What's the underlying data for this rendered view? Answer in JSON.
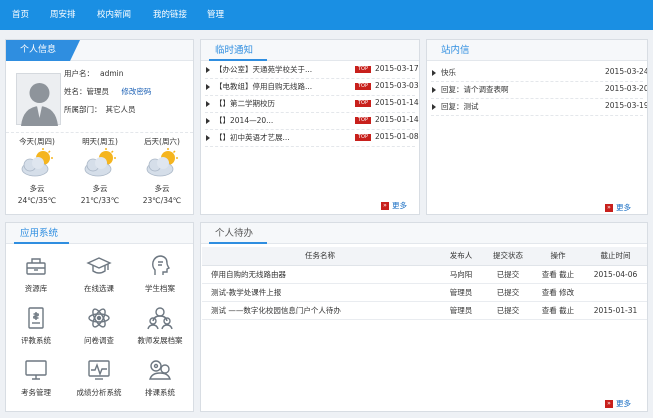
{
  "nav": [
    "首页",
    "周安排",
    "校内新闻",
    "我的链接",
    "管理"
  ],
  "personal": {
    "title": "个人信息",
    "username_label": "用户名：",
    "username": "admin",
    "name_label": "姓名：",
    "name": "管理员",
    "change_password": "修改密码",
    "dept_label": "所属部门：",
    "dept": "其它人员"
  },
  "weather": [
    {
      "day": "今天(周四)",
      "desc": "多云",
      "temp": "24℃/35℃",
      "icon": "partly-cloudy-icon"
    },
    {
      "day": "明天(周五)",
      "desc": "多云",
      "temp": "21℃/33℃",
      "icon": "partly-cloudy-icon"
    },
    {
      "day": "后天(周六)",
      "desc": "多云",
      "temp": "23℃/34℃",
      "icon": "partly-cloudy-icon"
    }
  ],
  "notices": {
    "title": "临时通知",
    "items": [
      {
        "title": "【办公室】天通苑学校关于...",
        "badge": "TOP",
        "date": "2015-03-17"
      },
      {
        "title": "【电教组】停用自购无线路...",
        "badge": "TOP",
        "date": "2015-03-03"
      },
      {
        "title": "【】第二学期校历",
        "badge": "TOP",
        "date": "2015-01-14"
      },
      {
        "title": "【】2014—20...",
        "badge": "TOP",
        "date": "2015-01-14"
      },
      {
        "title": "【】初中英语才艺展...",
        "badge": "TOP",
        "date": "2015-01-08"
      }
    ],
    "more": "更多"
  },
  "messages": {
    "title": "站内信",
    "items": [
      {
        "title": "快乐",
        "date": "2015-03-24"
      },
      {
        "title": "回复：请个调查表啊",
        "date": "2015-03-20"
      },
      {
        "title": "回复：测试",
        "date": "2015-03-19"
      }
    ],
    "more": "更多"
  },
  "apps": {
    "title": "应用系统",
    "items": [
      {
        "label": "资源库",
        "icon": "resource-icon"
      },
      {
        "label": "在线选课",
        "icon": "graduation-cap-icon"
      },
      {
        "label": "学生档案",
        "icon": "student-profile-icon"
      },
      {
        "label": "评教系统",
        "icon": "evaluation-icon"
      },
      {
        "label": "问卷调查",
        "icon": "survey-icon"
      },
      {
        "label": "教师发展档案",
        "icon": "teacher-group-icon"
      },
      {
        "label": "考务管理",
        "icon": "monitor-icon"
      },
      {
        "label": "成绩分析系统",
        "icon": "analysis-icon"
      },
      {
        "label": "排课系统",
        "icon": "schedule-icon"
      }
    ]
  },
  "todo": {
    "title": "个人待办",
    "columns": [
      "任务名称",
      "发布人",
      "提交状态",
      "操作",
      "截止时间"
    ],
    "rows": [
      {
        "task": "停用自购的无线路由器",
        "publisher": "马向阳",
        "status": "已提交",
        "action": "查看 截止",
        "deadline": "2015-04-06"
      },
      {
        "task": "测试-教学处课件上报",
        "publisher": "管理员",
        "status": "已提交",
        "action": "查看 修改",
        "deadline": ""
      },
      {
        "task": "测试 ——数字化校园信息门户个人待办",
        "publisher": "管理员",
        "status": "已提交",
        "action": "查看 截止",
        "deadline": "2015-01-31"
      }
    ],
    "more": "更多"
  },
  "colors": {
    "nav": "#1a8fe3",
    "accent": "#2f8ee0",
    "badge": "#c8201c"
  }
}
